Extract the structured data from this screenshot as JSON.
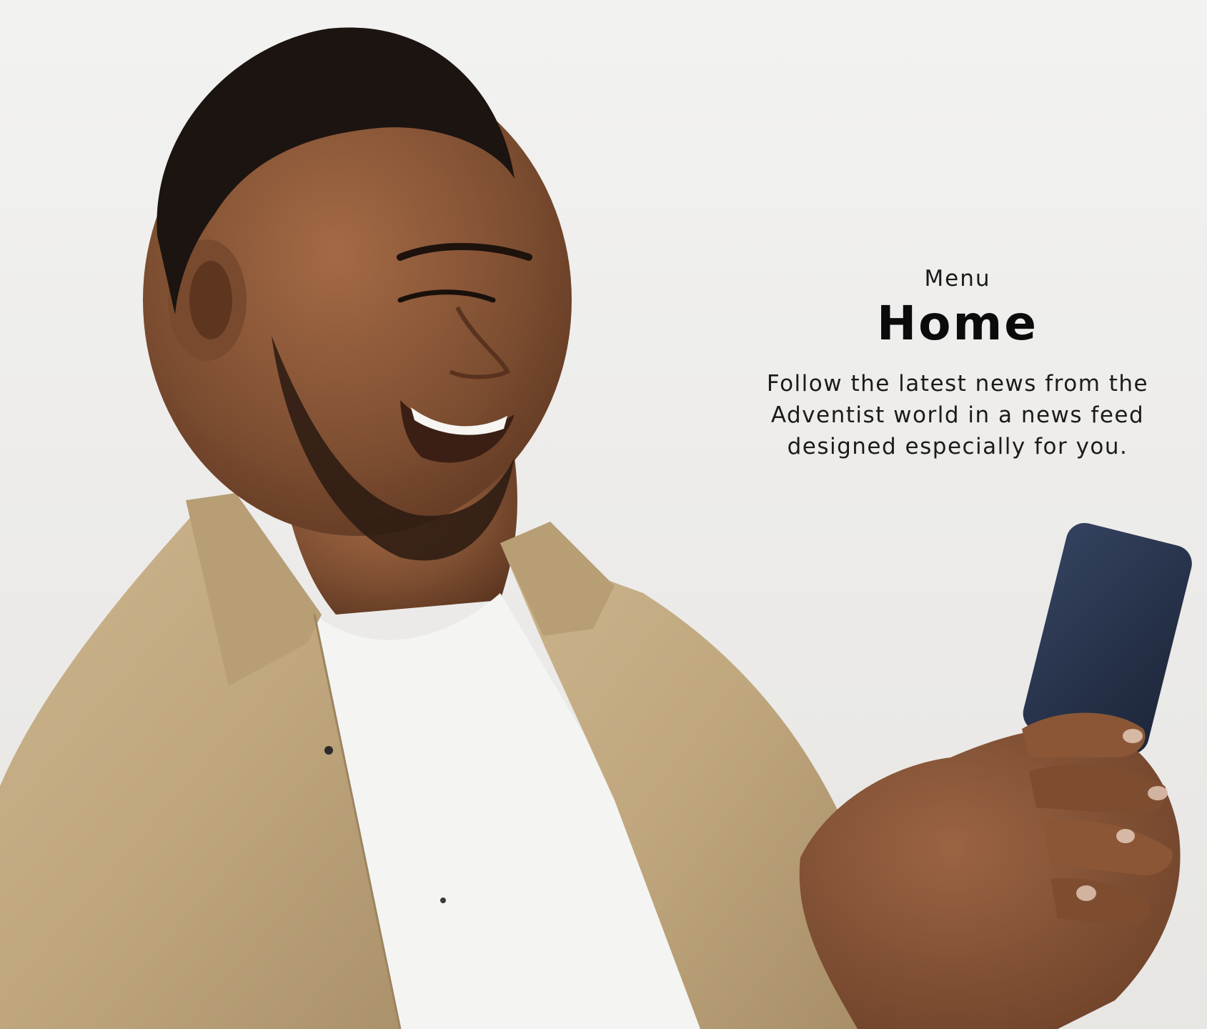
{
  "menu": {
    "eyebrow": "Menu",
    "title": "Home",
    "description_lines": [
      "Follow the latest news from the",
      "Adventist world in a news feed",
      "designed especially for you."
    ]
  },
  "colors": {
    "background": "#eeeeec",
    "text": "#111111",
    "shirt": "#c4ad86",
    "skin": "#8a5a3b",
    "phone": "#243148"
  },
  "photo": {
    "subject": "smiling-man-holding-phone"
  }
}
